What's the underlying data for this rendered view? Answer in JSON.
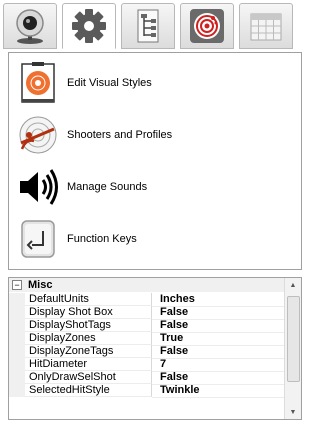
{
  "toolbar": {
    "tabs": [
      {
        "icon": "webcam-icon"
      },
      {
        "icon": "gear-icon"
      },
      {
        "icon": "hierarchy-icon"
      },
      {
        "icon": "target-icon"
      },
      {
        "icon": "calendar-grid-icon"
      }
    ],
    "active_index": 1
  },
  "menu": {
    "items": [
      {
        "label": "Edit Visual Styles",
        "icon": "target-style-icon"
      },
      {
        "label": "Shooters and Profiles",
        "icon": "shooter-profile-icon"
      },
      {
        "label": "Manage Sounds",
        "icon": "speaker-icon"
      },
      {
        "label": "Function Keys",
        "icon": "enter-key-icon"
      }
    ]
  },
  "properties": {
    "category": "Misc",
    "collapse_glyph": "−",
    "rows": [
      {
        "key": "DefaultUnits",
        "value": "Inches"
      },
      {
        "key": "Display Shot Box",
        "value": "False"
      },
      {
        "key": "DisplayShotTags",
        "value": "False"
      },
      {
        "key": "DisplayZones",
        "value": "True"
      },
      {
        "key": "DisplayZoneTags",
        "value": "False"
      },
      {
        "key": "HitDiameter",
        "value": "7"
      },
      {
        "key": "OnlyDrawSelShot",
        "value": "False"
      },
      {
        "key": "SelectedHitStyle",
        "value": "Twinkle"
      }
    ]
  },
  "scrollbar": {
    "up": "▲",
    "down": "▼"
  }
}
